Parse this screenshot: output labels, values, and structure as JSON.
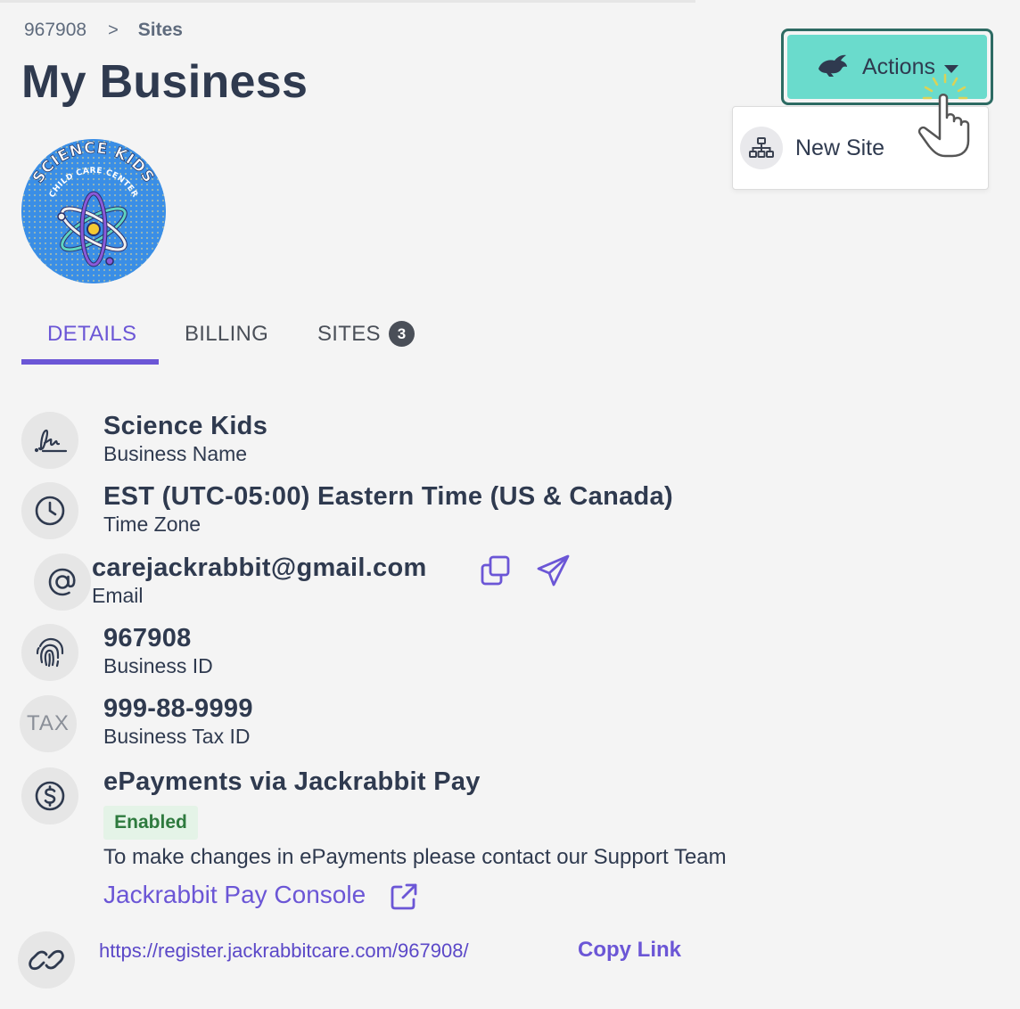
{
  "breadcrumb": {
    "parent": "967908",
    "separator": ">",
    "current": "Sites"
  },
  "page_title": "My Business",
  "actions": {
    "label": "Actions",
    "icon": "rabbit-icon",
    "menu": [
      {
        "label": "New Site",
        "icon": "sitemap-icon"
      }
    ]
  },
  "logo": {
    "line1": "SCIENCE KIDS",
    "line2": "CHILD CARE CENTER"
  },
  "tabs": [
    {
      "label": "DETAILS",
      "active": true
    },
    {
      "label": "BILLING",
      "active": false
    },
    {
      "label": "SITES",
      "badge": "3",
      "active": false
    }
  ],
  "details": {
    "business_name": {
      "value": "Science Kids",
      "label": "Business Name",
      "icon": "signature-icon"
    },
    "time_zone": {
      "value": "EST (UTC-05:00) Eastern Time (US & Canada)",
      "label": "Time Zone",
      "icon": "clock-icon"
    },
    "email": {
      "value": "carejackrabbit@gmail.com",
      "label": "Email",
      "icon": "at-icon"
    },
    "business_id": {
      "value": "967908",
      "label": "Business ID",
      "icon": "fingerprint-icon"
    },
    "tax_id": {
      "value": "999-88-9999",
      "label": "Business Tax ID",
      "icon_text": "TAX"
    },
    "epayments": {
      "value": "ePayments via Jackrabbit Pay",
      "status": "Enabled",
      "note": "To make changes in ePayments please contact our Support Team",
      "console_link": "Jackrabbit Pay Console",
      "icon": "dollar-icon"
    },
    "register": {
      "url": "https://register.jackrabbitcare.com/967908/",
      "copy_label": "Copy Link",
      "icon": "link-icon"
    }
  },
  "colors": {
    "accent": "#6b56d6",
    "actions_bg": "#6adbcc",
    "text": "#2f3a4f",
    "enabled_bg": "#e4f3e7"
  }
}
